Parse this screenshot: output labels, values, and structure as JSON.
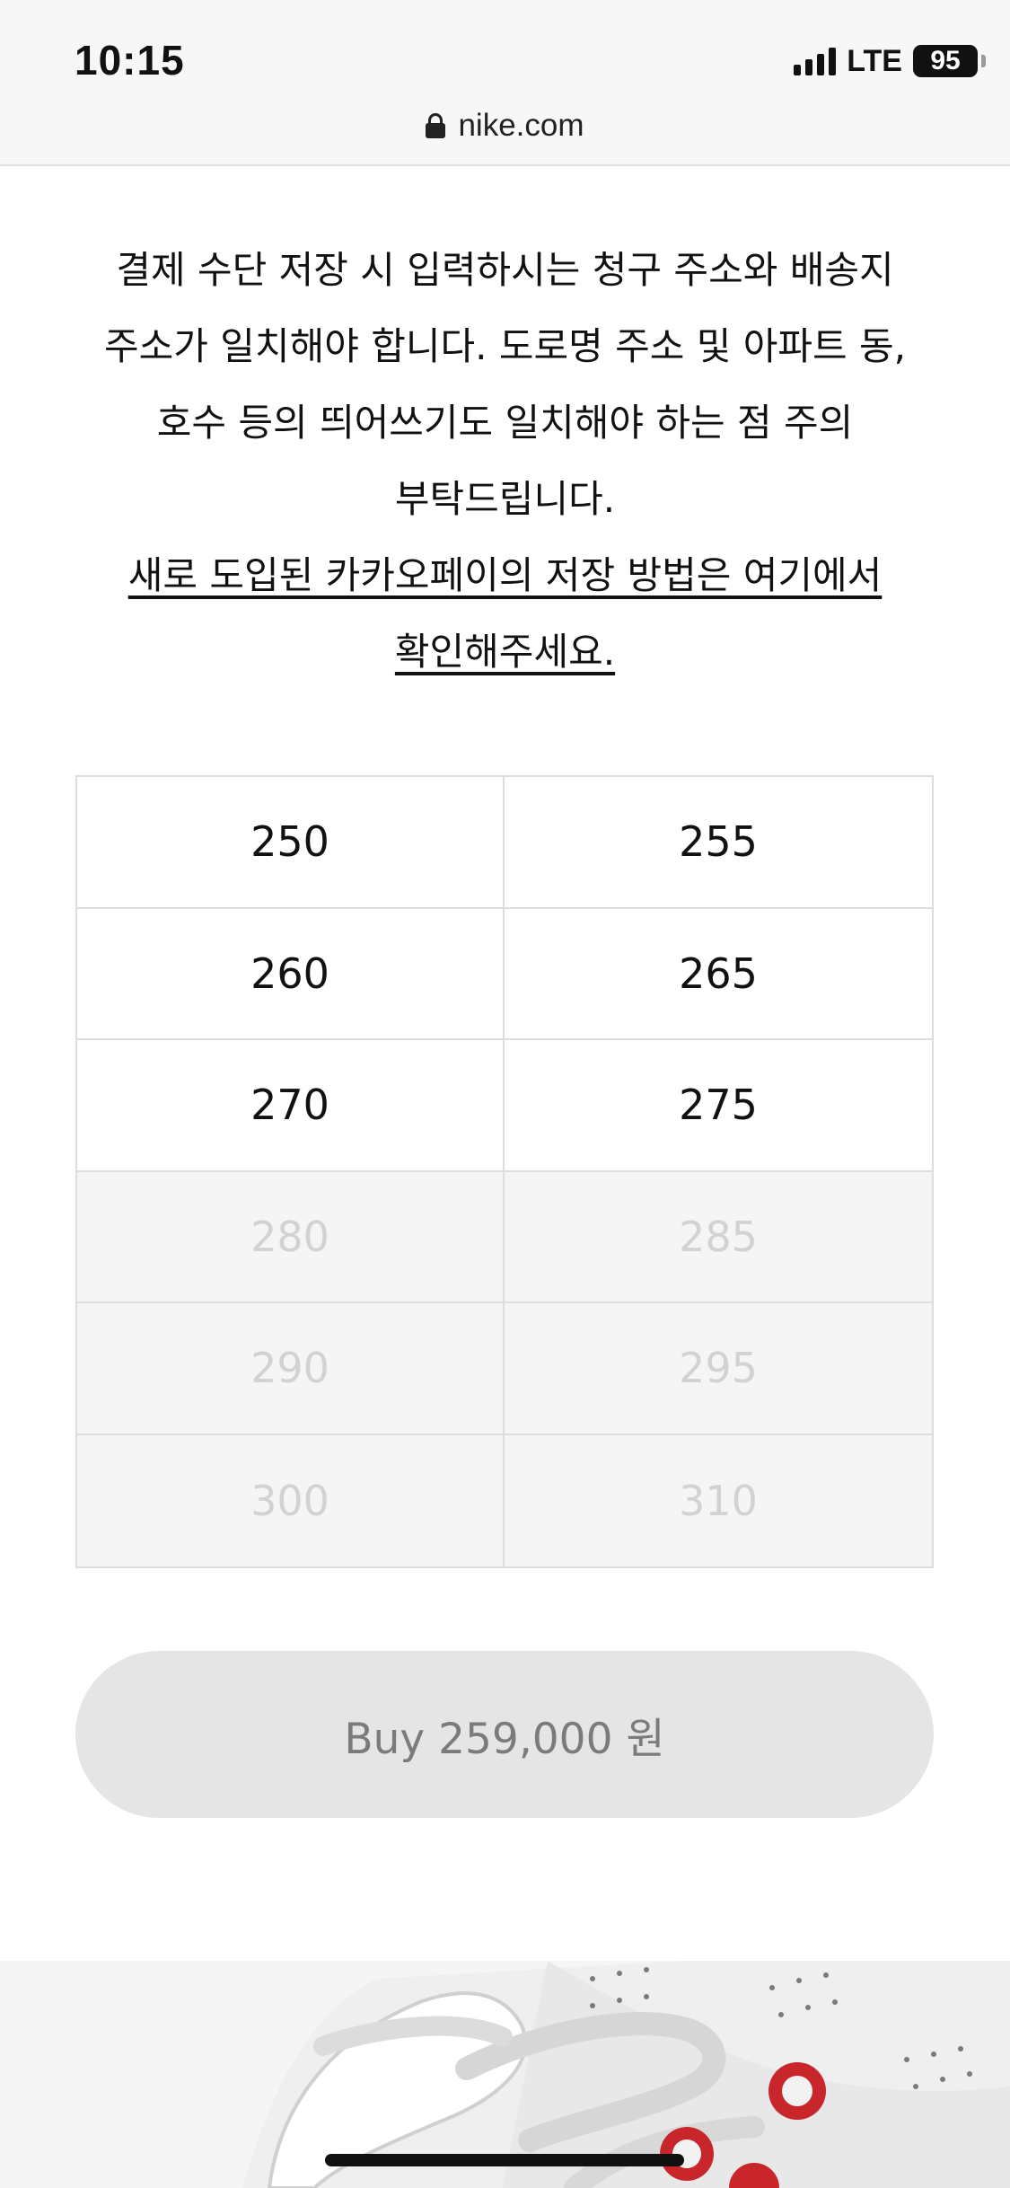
{
  "status_bar": {
    "time": "10:15",
    "network": "LTE",
    "battery": "95"
  },
  "browser": {
    "url": "nike.com"
  },
  "notice": {
    "lines": [
      "결제 수단 저장 시 입력하시는 청구 주소와 배송지",
      "주소가 일치해야 합니다. 도로명 주소 및 아파트 동,",
      "호수 등의 띄어쓰기도 일치해야 하는 점 주의",
      "부탁드립니다."
    ],
    "link_lines": [
      "새로 도입된 카카오페이의 저장 방법은 여기에서",
      "확인해주세요."
    ]
  },
  "sizes": [
    {
      "label": "250",
      "available": true
    },
    {
      "label": "255",
      "available": true
    },
    {
      "label": "260",
      "available": true
    },
    {
      "label": "265",
      "available": true
    },
    {
      "label": "270",
      "available": true
    },
    {
      "label": "275",
      "available": true
    },
    {
      "label": "280",
      "available": false
    },
    {
      "label": "285",
      "available": false
    },
    {
      "label": "290",
      "available": false
    },
    {
      "label": "295",
      "available": false
    },
    {
      "label": "300",
      "available": false
    },
    {
      "label": "310",
      "available": false
    }
  ],
  "buy_button": {
    "label": "Buy 259,000 원"
  },
  "colors": {
    "accent_eyelet": "#c8262b",
    "disabled_text": "#d2d2d2",
    "button_bg": "#e5e5e5"
  }
}
